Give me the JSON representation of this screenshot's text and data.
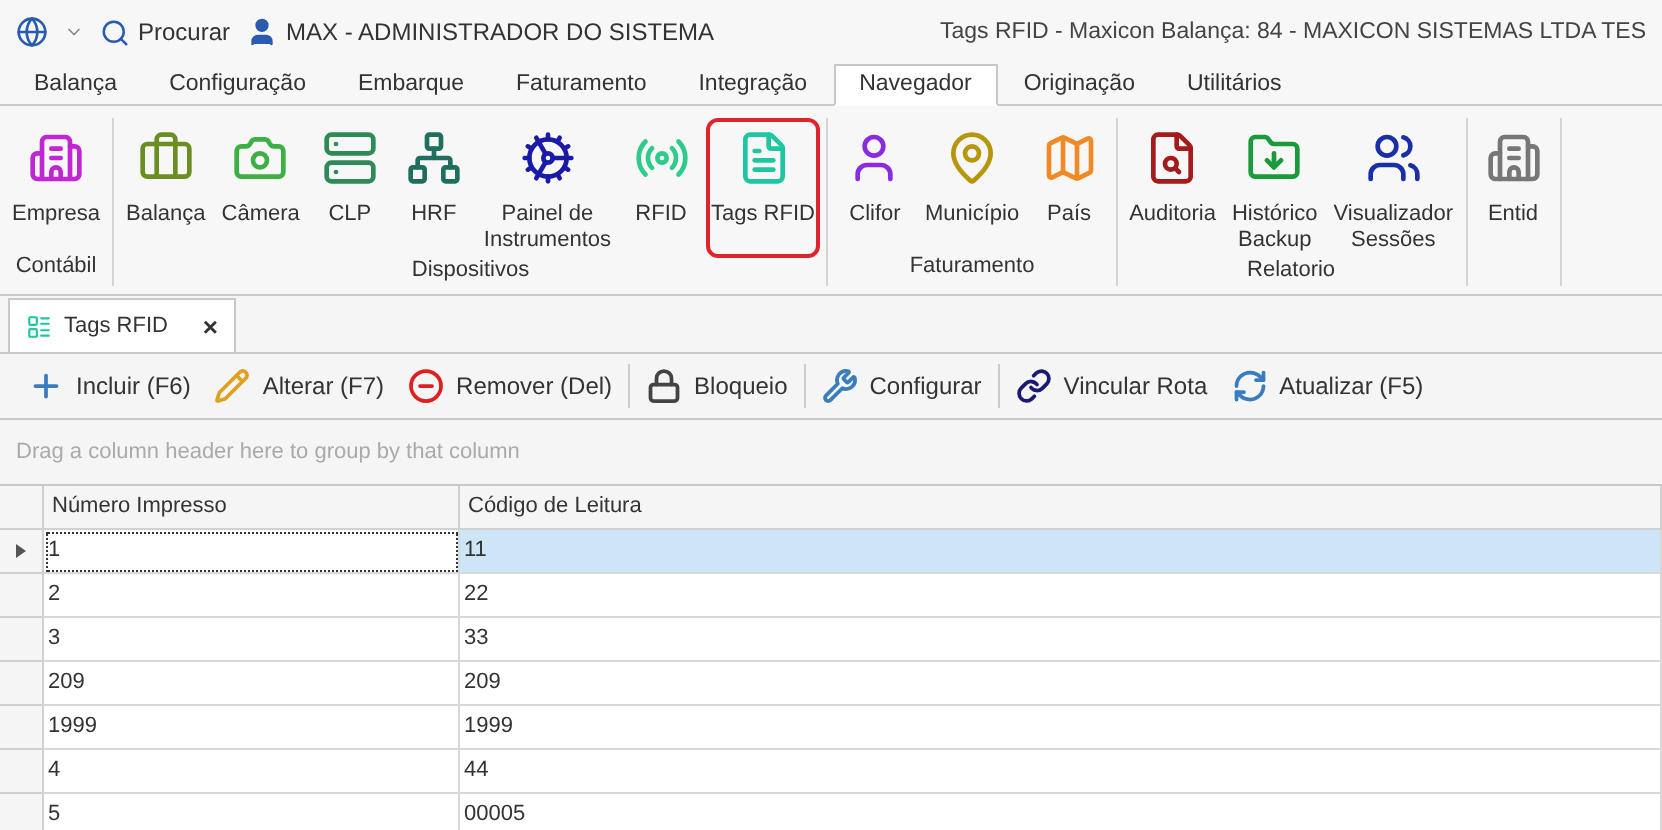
{
  "title_bar": {
    "search_label": "Procurar",
    "user": "MAX - ADMINISTRADOR DO SISTEMA",
    "title": "Tags RFID - Maxicon Balança: 84 - MAXICON SISTEMAS LTDA TES"
  },
  "ribbon_tabs": [
    {
      "label": "Balança",
      "selected": false
    },
    {
      "label": "Configuração",
      "selected": false
    },
    {
      "label": "Embarque",
      "selected": false
    },
    {
      "label": "Faturamento",
      "selected": false
    },
    {
      "label": "Integração",
      "selected": false
    },
    {
      "label": "Navegador",
      "selected": true
    },
    {
      "label": "Originação",
      "selected": false
    },
    {
      "label": "Utilitários",
      "selected": false
    }
  ],
  "ribbon_groups": [
    {
      "label": "Contábil",
      "items": [
        {
          "label": "Empresa",
          "selected": false
        }
      ]
    },
    {
      "label": "Dispositivos",
      "items": [
        {
          "label": "Balança",
          "selected": false
        },
        {
          "label": "Câmera",
          "selected": false
        },
        {
          "label": "CLP",
          "selected": false
        },
        {
          "label": "HRF",
          "selected": false
        },
        {
          "label": "Painel de Instrumentos",
          "selected": false
        },
        {
          "label": "RFID",
          "selected": false
        },
        {
          "label": "Tags RFID",
          "selected": true
        }
      ]
    },
    {
      "label": "Faturamento",
      "items": [
        {
          "label": "Clifor",
          "selected": false
        },
        {
          "label": "Município",
          "selected": false
        },
        {
          "label": "País",
          "selected": false
        }
      ]
    },
    {
      "label": "Relatorio",
      "items": [
        {
          "label": "Auditoria",
          "selected": false
        },
        {
          "label": "Histórico Backup",
          "selected": false
        },
        {
          "label": "Visualizador Sessões",
          "selected": false
        }
      ]
    },
    {
      "items": [
        {
          "label": "Entid",
          "selected": false
        }
      ]
    }
  ],
  "document_tab": {
    "label": "Tags RFID",
    "close": "×"
  },
  "toolbar": [
    "Incluir (F6)",
    "Alterar (F7)",
    "Remover (Del)",
    "Bloqueio",
    "Configurar",
    "Vincular Rota",
    "Atualizar (F5)"
  ],
  "group_panel": {
    "placeholder": "Drag a column header here to group by that column"
  },
  "table": {
    "columns": [
      "Número Impresso",
      "Código de Leitura"
    ],
    "rows": [
      {
        "cells": [
          "1",
          "11"
        ],
        "selected": true
      },
      {
        "cells": [
          "2",
          "22"
        ],
        "selected": false
      },
      {
        "cells": [
          "3",
          "33"
        ],
        "selected": false
      },
      {
        "cells": [
          "209",
          "209"
        ],
        "selected": false
      },
      {
        "cells": [
          "1999",
          "1999"
        ],
        "selected": false
      },
      {
        "cells": [
          "4",
          "44"
        ],
        "selected": false
      },
      {
        "cells": [
          "5",
          "00005"
        ],
        "selected": false
      }
    ]
  }
}
